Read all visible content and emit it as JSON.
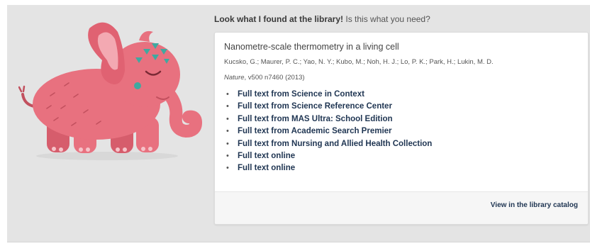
{
  "header": {
    "lead": "Look what I found at the library!",
    "rest": "Is this what you need?"
  },
  "mascot": {
    "icon": "pink-elephant-icon",
    "body_color": "#e8717f",
    "accent_color": "#3fa9a0"
  },
  "result": {
    "title": "Nanometre-scale thermometry in a living cell",
    "authors": "Kucsko, G.; Maurer, P. C.; Yao, N. Y.; Kubo, M.; Noh, H. J.; Lo, P. K.; Park, H.; Lukin, M. D.",
    "journal": "Nature",
    "volume_info": ", v500 n7460 (2013)",
    "links": [
      {
        "label": "Full text from Science in Context"
      },
      {
        "label": "Full text from Science Reference Center"
      },
      {
        "label": "Full text from MAS Ultra: School Edition"
      },
      {
        "label": "Full text from Academic Search Premier"
      },
      {
        "label": "Full text from Nursing and Allied Health Collection"
      },
      {
        "label": "Full text online"
      },
      {
        "label": "Full text online"
      }
    ]
  },
  "footer": {
    "catalog_label": "View in the library catalog"
  }
}
